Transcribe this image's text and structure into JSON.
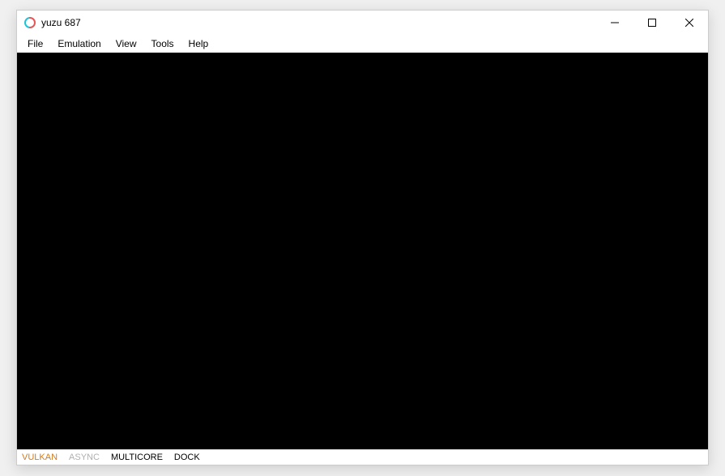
{
  "window": {
    "title": "yuzu 687"
  },
  "menubar": {
    "items": [
      "File",
      "Emulation",
      "View",
      "Tools",
      "Help"
    ]
  },
  "statusbar": {
    "vulkan": "VULKAN",
    "async": "ASYNC",
    "multicore": "MULTICORE",
    "dock": "DOCK"
  },
  "colors": {
    "status_vulkan": "#d77a1a",
    "status_async": "#b0b0b0",
    "viewport_bg": "#000000"
  }
}
